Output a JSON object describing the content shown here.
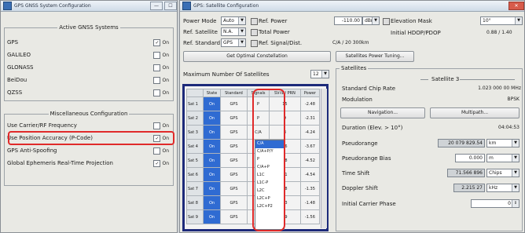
{
  "left_window": {
    "title": "GPS GNSS System Configuration",
    "btn_min": "—",
    "btn_max": "☐",
    "active_group": {
      "legend": "Active GNSS Systems",
      "items": [
        {
          "label": "GPS",
          "state": "On",
          "checked": true
        },
        {
          "label": "GALILEO",
          "state": "On",
          "checked": false
        },
        {
          "label": "GLONASS",
          "state": "On",
          "checked": false
        },
        {
          "label": "BeiDou",
          "state": "On",
          "checked": false
        },
        {
          "label": "QZSS",
          "state": "On",
          "checked": false
        }
      ]
    },
    "misc_group": {
      "legend": "Miscellaneous Configuration",
      "items": [
        {
          "label": "Use Carrier/RF Frequency",
          "state": "On",
          "checked": false
        },
        {
          "label": "Use Position Accuracy (P-Code)",
          "state": "On",
          "checked": true
        },
        {
          "label": "GPS Anti-Spoofing",
          "state": "On",
          "checked": false
        },
        {
          "label": "Global Ephemeris Real-Time Projection",
          "state": "On",
          "checked": true
        }
      ]
    }
  },
  "right_window": {
    "title": "GPS: Satellite Configuration",
    "power_mode_label": "Power Mode",
    "power_mode_value": "Auto",
    "ref_satellite_label": "Ref. Satellite",
    "ref_satellite_value": "N.A.",
    "ref_standard_label": "Ref. Standard",
    "ref_standard_value": "GPS",
    "ref_power_label": "Ref. Power",
    "ref_power_value": "-110.00",
    "ref_power_unit": "dBm",
    "total_power_label": "Total Power",
    "ref_signal_label": "Ref. Signal/Dist.",
    "ref_signal_value": "C/A / 20 300km",
    "elevation_mask_label": "Elevation Mask",
    "elevation_mask_value": "10°",
    "hdop_label": "Initial HDOP/PDOP",
    "hdop_value": "0.88 / 1.40",
    "get_optimal_button": "Get Optimal Constellation",
    "power_tuning_button": "Satellites Power Tuning...",
    "max_sats_label": "Maximum Number Of Satellites",
    "max_sats_value": "12",
    "satellites_legend": "Satellites",
    "table_headers": [
      "State",
      "Standard",
      "Signals",
      "SV-ID/ PRN",
      "Power"
    ],
    "table_rows": [
      {
        "name": "Sat 1",
        "state": "On",
        "std": "GPS",
        "sig": "P",
        "id": "15",
        "pwr": "-2.48"
      },
      {
        "name": "Sat 2",
        "state": "On",
        "std": "GPS",
        "sig": "P",
        "id": "9",
        "pwr": "-2.31"
      },
      {
        "name": "Sat 3",
        "state": "On",
        "std": "GPS",
        "sig": "C/A",
        "id": "3",
        "pwr": "-4.24"
      },
      {
        "name": "Sat 4",
        "state": "On",
        "std": "GPS",
        "sig": "C/A",
        "id": "26",
        "pwr": "-3.67"
      },
      {
        "name": "Sat 5",
        "state": "On",
        "std": "GPS",
        "sig": "P",
        "id": "28",
        "pwr": "-4.52"
      },
      {
        "name": "Sat 6",
        "state": "On",
        "std": "GPS",
        "sig": "P",
        "id": "21",
        "pwr": "-4.54"
      },
      {
        "name": "Sat 7",
        "state": "On",
        "std": "GPS",
        "sig": "P",
        "id": "18",
        "pwr": "-1.35"
      },
      {
        "name": "Sat 8",
        "state": "On",
        "std": "GPS",
        "sig": "P",
        "id": "13",
        "pwr": "-1.48"
      },
      {
        "name": "Sat 9",
        "state": "On",
        "std": "GPS",
        "sig": "P",
        "id": "29",
        "pwr": "-1.56"
      }
    ],
    "signal_options": [
      "C/A",
      "C/A+P/Y",
      "P",
      "C/A+P",
      "L1C",
      "L1C-P",
      "L2C",
      "L2C+P",
      "L2C+P2"
    ],
    "satellite_group_title": "Satellite 3",
    "standard_chip_rate_label": "Standard Chip Rate",
    "standard_chip_rate_value": "1.023 000 00 MHz",
    "modulation_label": "Modulation",
    "modulation_value": "BPSK",
    "navigation_button": "Navigation...",
    "multipath_button": "Multipath...",
    "duration_label": "Duration (Elev. > 10°)",
    "duration_value": "04:04:53",
    "pseudorange_label": "Pseudorange",
    "pseudorange_value": "20 079 829.54",
    "pseudorange_unit": "km",
    "pseudorange_bias_label": "Pseudorange Bias",
    "pseudorange_bias_value": "0.000",
    "pseudorange_bias_unit": "m",
    "time_shift_label": "Time Shift",
    "time_shift_value": "71.566 896",
    "time_shift_unit": "Chips",
    "doppler_label": "Doppler Shift",
    "doppler_value": "2.215 27",
    "doppler_unit": "kHz",
    "carrier_phase_label": "Initial Carrier Phase",
    "carrier_phase_value": "0"
  },
  "colors": {
    "highlight_red": "#e02a2a",
    "table_border_navy": "#1d2a7a",
    "state_blue": "#2f6bd2"
  }
}
